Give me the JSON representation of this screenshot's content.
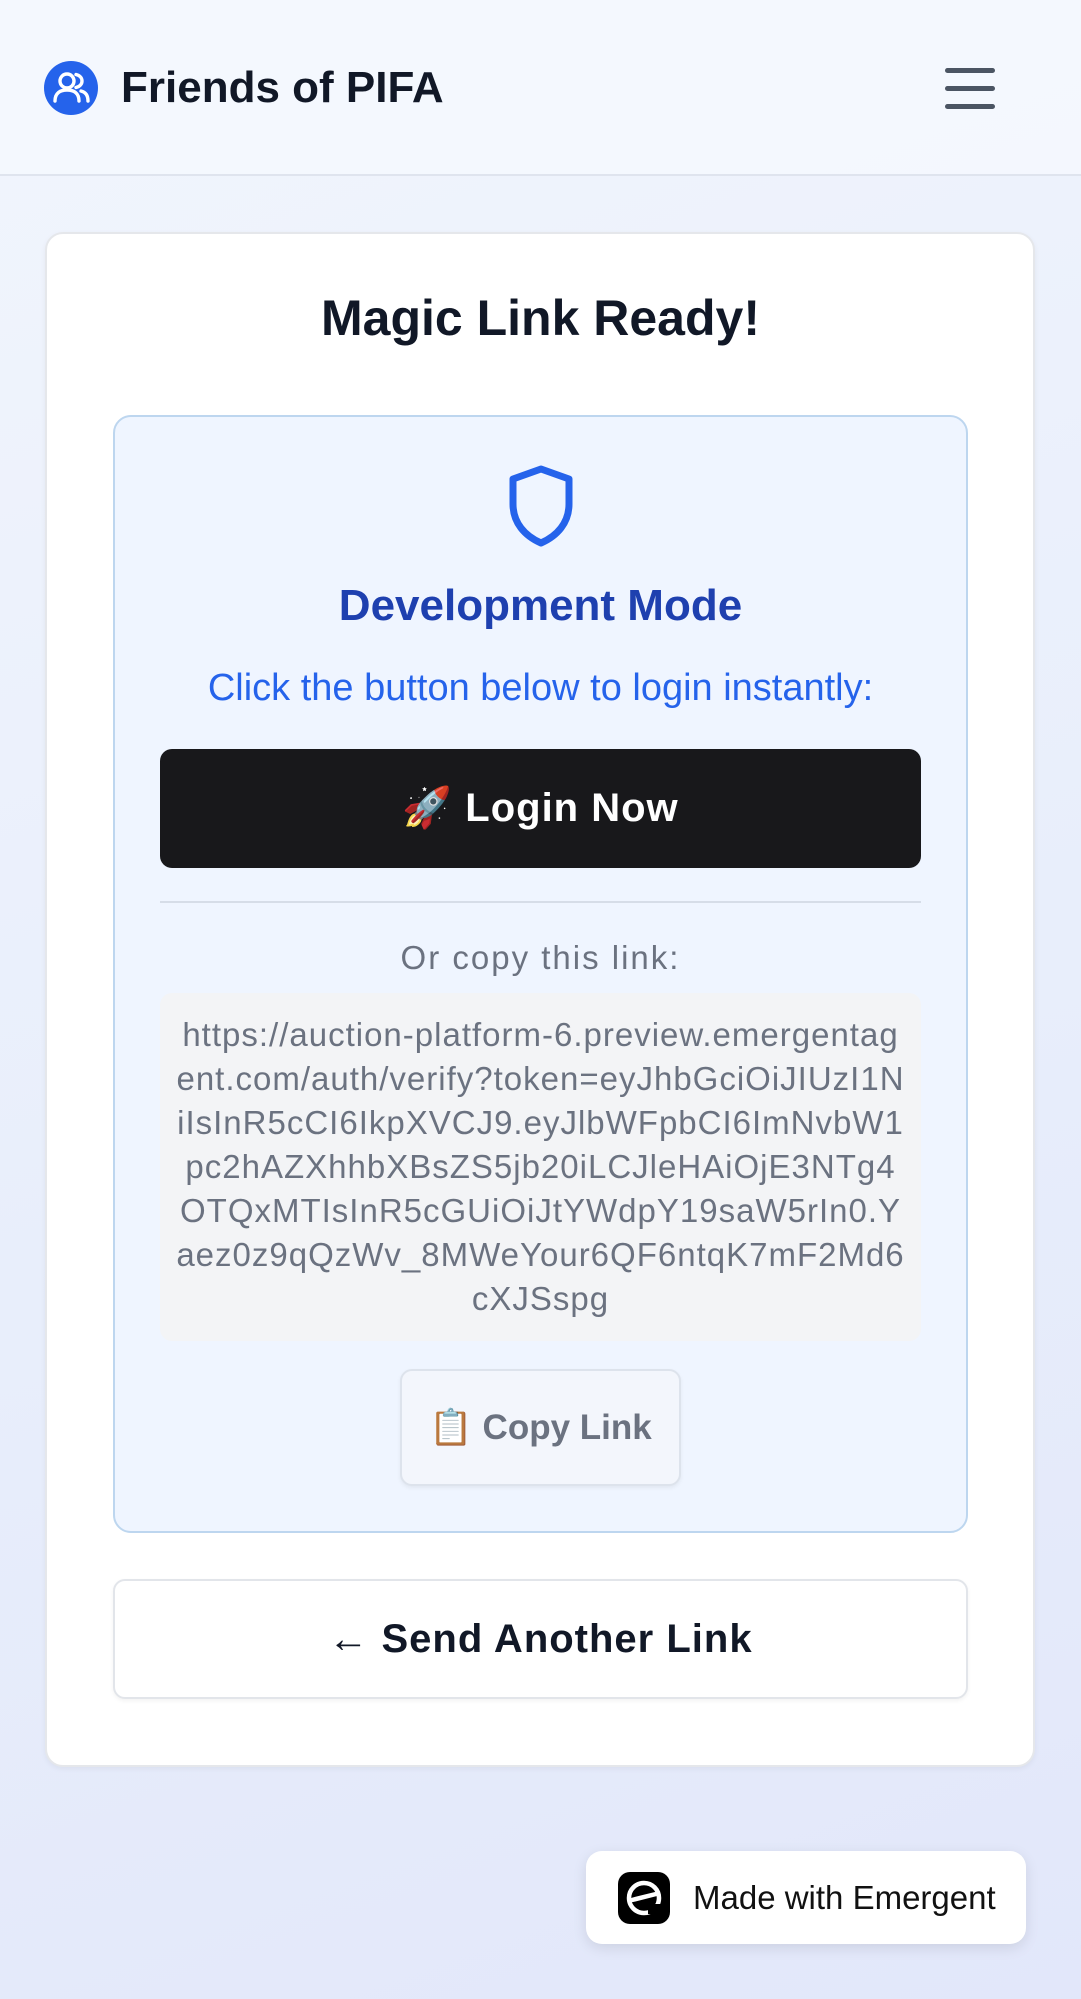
{
  "header": {
    "title": "Friends of PIFA",
    "brand_icon": "users-icon",
    "menu_icon": "hamburger-menu-icon"
  },
  "card": {
    "title": "Magic Link Ready!",
    "dev_panel": {
      "icon": "shield-icon",
      "heading": "Development Mode",
      "instruction": "Click the button below to login instantly:",
      "login_button_label": "🚀 Login Now",
      "copy_label": "Or copy this link:",
      "link": "https://auction-platform-6.preview.emergentagent.com/auth/verify?token=eyJhbGciOiJIUzI1NiIsInR5cCI6IkpXVCJ9.eyJlbWFpbCI6ImNvbW1pc2hAZXhhbXBsZS5jb20iLCJleHAiOjE3NTg4OTQxMTIsInR5cGUiOiJtYWdpY19saW5rIn0.Yaez0z9qQzWv_8MWeYour6QF6ntqK7mF2Md6cXJSspg",
      "copy_button_label": "📋 Copy Link"
    },
    "send_another_label": "← Send Another Link"
  },
  "badge": {
    "logo_icon": "emergent-logo-icon",
    "label": "Made with Emergent"
  },
  "colors": {
    "brand_blue": "#2563eb",
    "dev_heading": "#1e40af",
    "dev_panel_bg": "#eff5ff",
    "login_button_bg": "#18181b"
  }
}
